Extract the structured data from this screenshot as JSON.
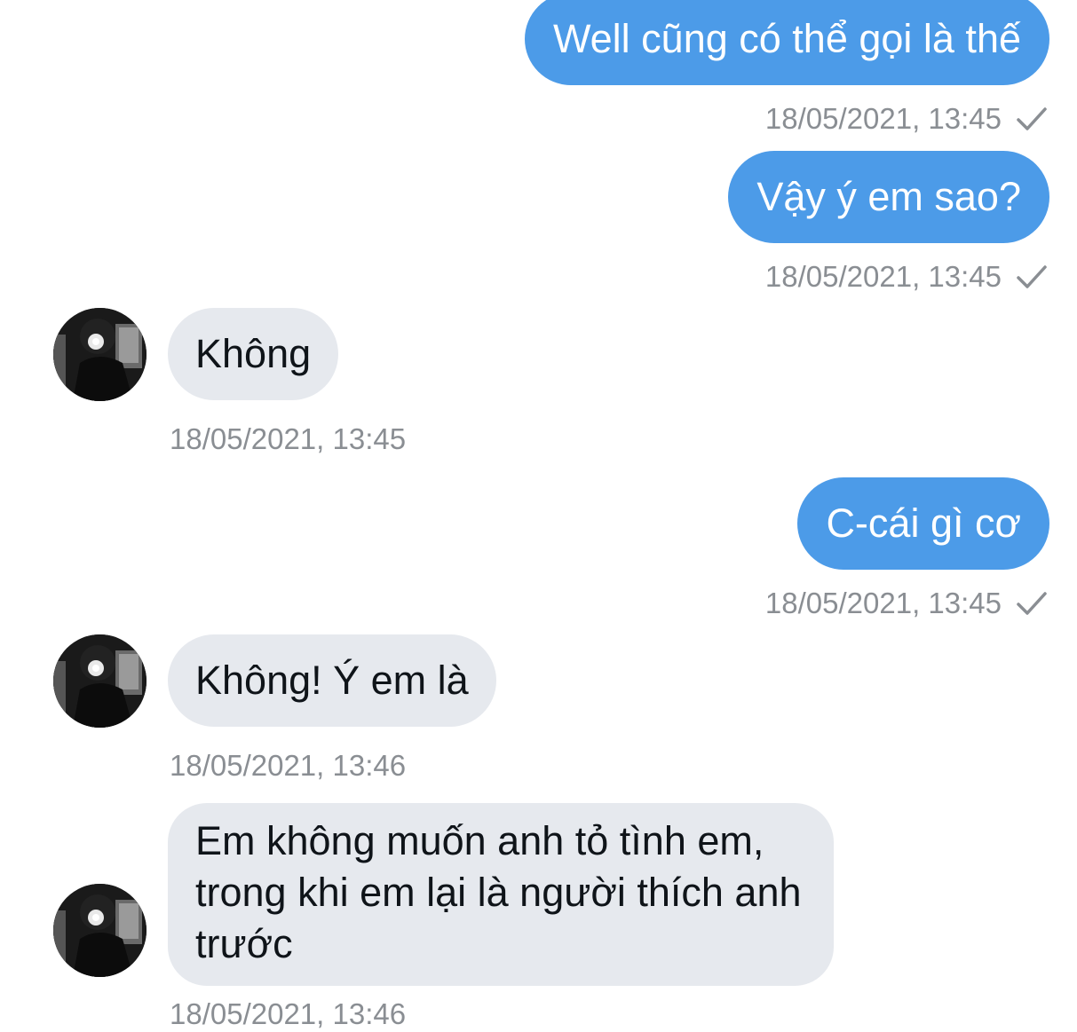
{
  "messages": [
    {
      "direction": "outgoing",
      "text": "Well cũng có thể gọi là thế",
      "time": "18/05/2021, 13:45",
      "status_icon": "check-icon"
    },
    {
      "direction": "outgoing",
      "text": "Vậy ý em sao?",
      "time": "18/05/2021, 13:45",
      "status_icon": "check-icon"
    },
    {
      "direction": "incoming",
      "text": "Không",
      "time": "18/05/2021, 13:45"
    },
    {
      "direction": "outgoing",
      "text": "C-cái gì cơ",
      "time": "18/05/2021, 13:45",
      "status_icon": "check-icon"
    },
    {
      "direction": "incoming",
      "text": "Không! Ý em là",
      "time": "18/05/2021, 13:46"
    },
    {
      "direction": "incoming",
      "text": "Em không muốn anh tỏ tình em, trong khi em lại là người thích anh trước",
      "time": "18/05/2021, 13:46"
    }
  ],
  "colors": {
    "outgoing_bubble": "#4c9be8",
    "incoming_bubble": "#e6e9ee",
    "timestamp": "#8a8e93"
  }
}
